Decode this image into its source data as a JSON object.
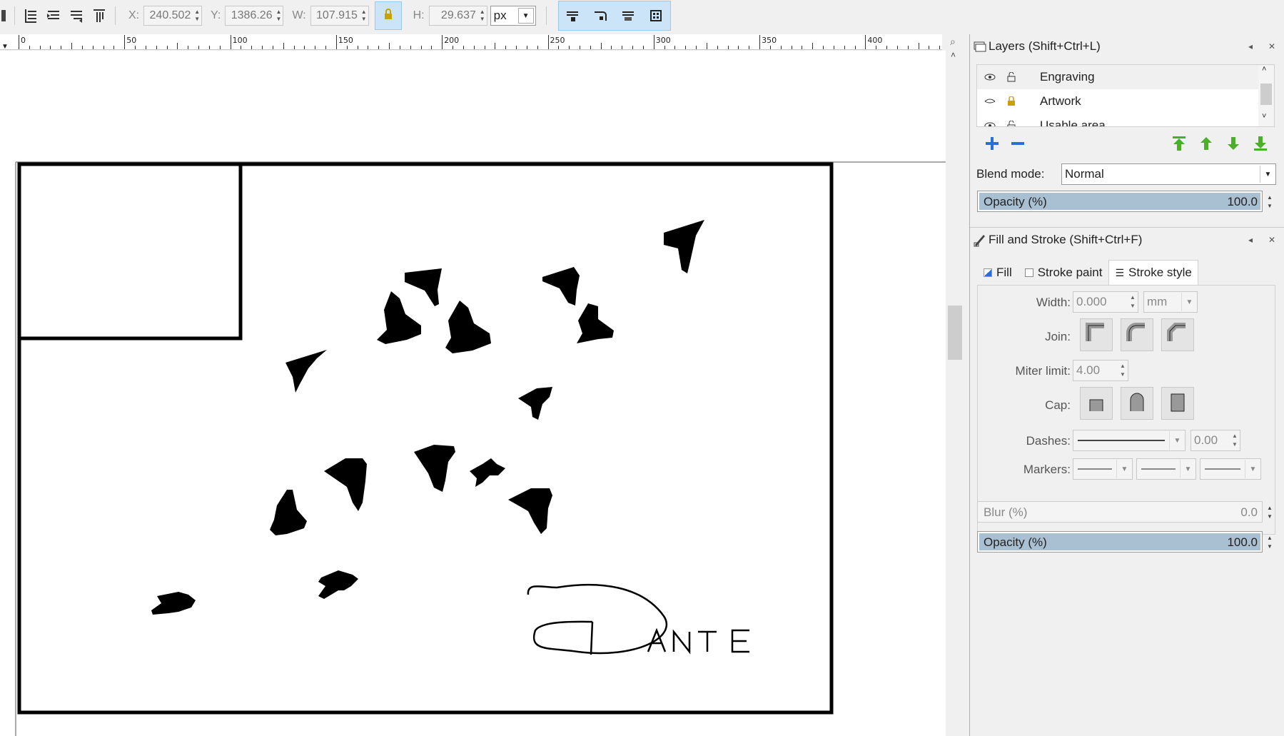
{
  "toolbar": {
    "x_label": "X:",
    "x_value": "240.502",
    "y_label": "Y:",
    "y_value": "1386.26",
    "w_label": "W:",
    "w_value": "107.915",
    "h_label": "H:",
    "h_value": "29.637",
    "unit": "px",
    "icons": [
      "align-bottom-icon",
      "raise-icon",
      "lower-icon",
      "align-top-icon"
    ],
    "transform_icons": [
      "scale-stroke-icon",
      "scale-corners-icon",
      "transform-gradients-icon",
      "transform-patterns-icon"
    ]
  },
  "ruler": {
    "labels": [
      "0",
      "50",
      "100",
      "150",
      "200",
      "250",
      "300",
      "350",
      "400"
    ]
  },
  "canvas": {
    "signature": "Dante"
  },
  "layers_panel": {
    "title": "Layers (Shift+Ctrl+L)",
    "layers": [
      {
        "name": "Engraving",
        "visible": true,
        "locked": false
      },
      {
        "name": "Artwork",
        "visible": false,
        "locked": true
      },
      {
        "name": "Usable area",
        "visible": true,
        "locked": false
      }
    ],
    "blend_mode_label": "Blend mode:",
    "blend_mode_value": "Normal",
    "opacity_label": "Opacity (%)",
    "opacity_value": "100.0"
  },
  "fill_stroke_panel": {
    "title": "Fill and Stroke (Shift+Ctrl+F)",
    "tabs": [
      "Fill",
      "Stroke paint",
      "Stroke style"
    ],
    "active_tab": "Stroke style",
    "width_label": "Width:",
    "width_value": "0.000",
    "width_unit": "mm",
    "join_label": "Join:",
    "miter_label": "Miter limit:",
    "miter_value": "4.00",
    "cap_label": "Cap:",
    "dashes_label": "Dashes:",
    "dashes_value": "0.00",
    "markers_label": "Markers:",
    "blur_label": "Blur (%)",
    "blur_value": "0.0",
    "opacity_label": "Opacity (%)",
    "opacity_value": "100.0"
  },
  "colors": {
    "accent_toggle": "#cce4f7",
    "slider_fill": "#a9bfd2",
    "arrow_green": "#4caf2a",
    "add_blue": "#2a6fd6"
  }
}
